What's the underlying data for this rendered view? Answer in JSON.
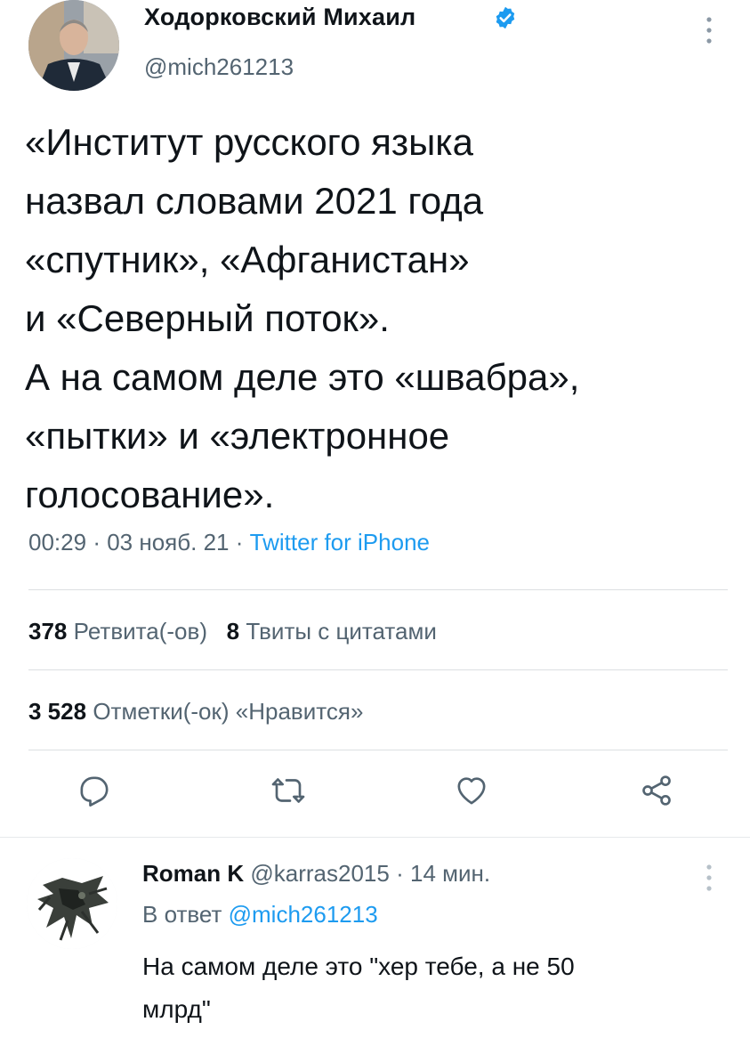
{
  "tweet": {
    "author_name": "Ходорковский Михаил",
    "handle": "@mich261213",
    "text_lines": [
      "«Институт русского языка",
      "назвал словами 2021 года",
      "«спутник», «Афганистан»",
      "и «Северный поток».",
      "А на самом деле это «швабра»,",
      "«пытки» и «электронное",
      "голосование»."
    ],
    "time": "00:29",
    "date": "03 нояб. 21",
    "separator": "·",
    "source": "Twitter for iPhone",
    "retweets_count": "378",
    "retweets_label": "Ретвита(-ов)",
    "quotes_count": "8",
    "quotes_label": "Твиты с цитатами",
    "likes_count": "3 528",
    "likes_label": "Отметки(-ок) «Нравится»"
  },
  "actions": {
    "icons": [
      "reply-icon",
      "retweet-icon",
      "like-icon",
      "share-icon"
    ]
  },
  "reply": {
    "author_name": "Roman K",
    "handle": "@karras2015",
    "separator": "·",
    "time_ago": "14 мин.",
    "reply_prefix": "В ответ",
    "reply_to": "@mich261213",
    "text_lines": [
      "На самом деле это \"хер тебе, а не 50",
      "млрд\""
    ]
  },
  "colors": {
    "accent": "#1d9bf0",
    "secondary_text": "#536471",
    "primary_text": "#0f1419",
    "divider": "#dcdfe2"
  }
}
